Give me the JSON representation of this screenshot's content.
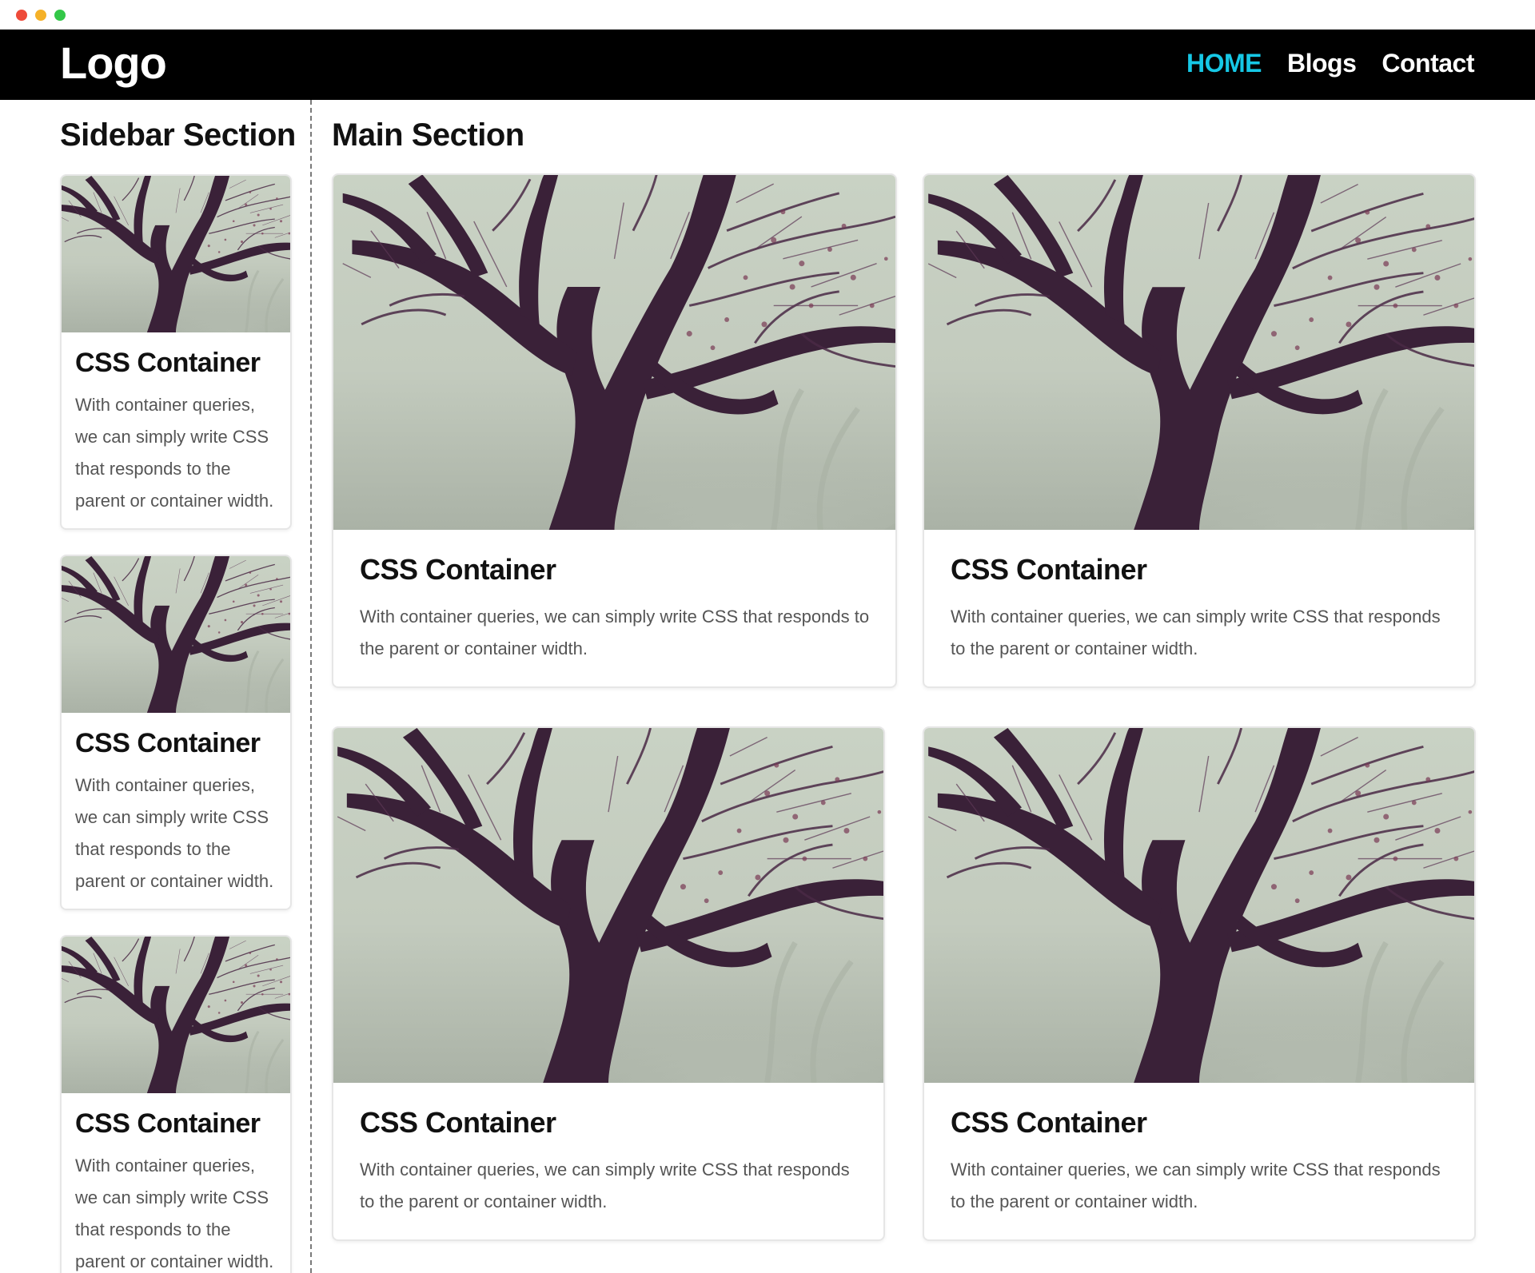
{
  "window": {
    "controls": [
      "close",
      "minimize",
      "maximize"
    ]
  },
  "header": {
    "logo": "Logo",
    "nav": [
      {
        "label": "HOME",
        "active": true
      },
      {
        "label": "Blogs",
        "active": false
      },
      {
        "label": "Contact",
        "active": false
      }
    ],
    "active_color": "#16c8e6"
  },
  "sidebar": {
    "title": "Sidebar Section",
    "cards": [
      {
        "title": "CSS Container",
        "text": "With container queries, we can simply write CSS that responds to the parent or container width."
      },
      {
        "title": "CSS Container",
        "text": "With container queries, we can simply write CSS that responds to the parent or container width."
      },
      {
        "title": "CSS Container",
        "text": "With container queries, we can simply write CSS that responds to the parent or container width."
      }
    ]
  },
  "main": {
    "title": "Main Section",
    "cards": [
      {
        "title": "CSS Container",
        "text": "With container queries, we can simply write CSS that responds to the parent or container width."
      },
      {
        "title": "CSS Container",
        "text": "With container queries, we can simply write CSS that responds to the parent or container width."
      },
      {
        "title": "CSS Container",
        "text": "With container queries, we can simply write CSS that responds to the parent or container width."
      },
      {
        "title": "CSS Container",
        "text": "With container queries, we can simply write CSS that responds to the parent or container width."
      }
    ]
  },
  "image": {
    "icon": "tree-photo"
  }
}
